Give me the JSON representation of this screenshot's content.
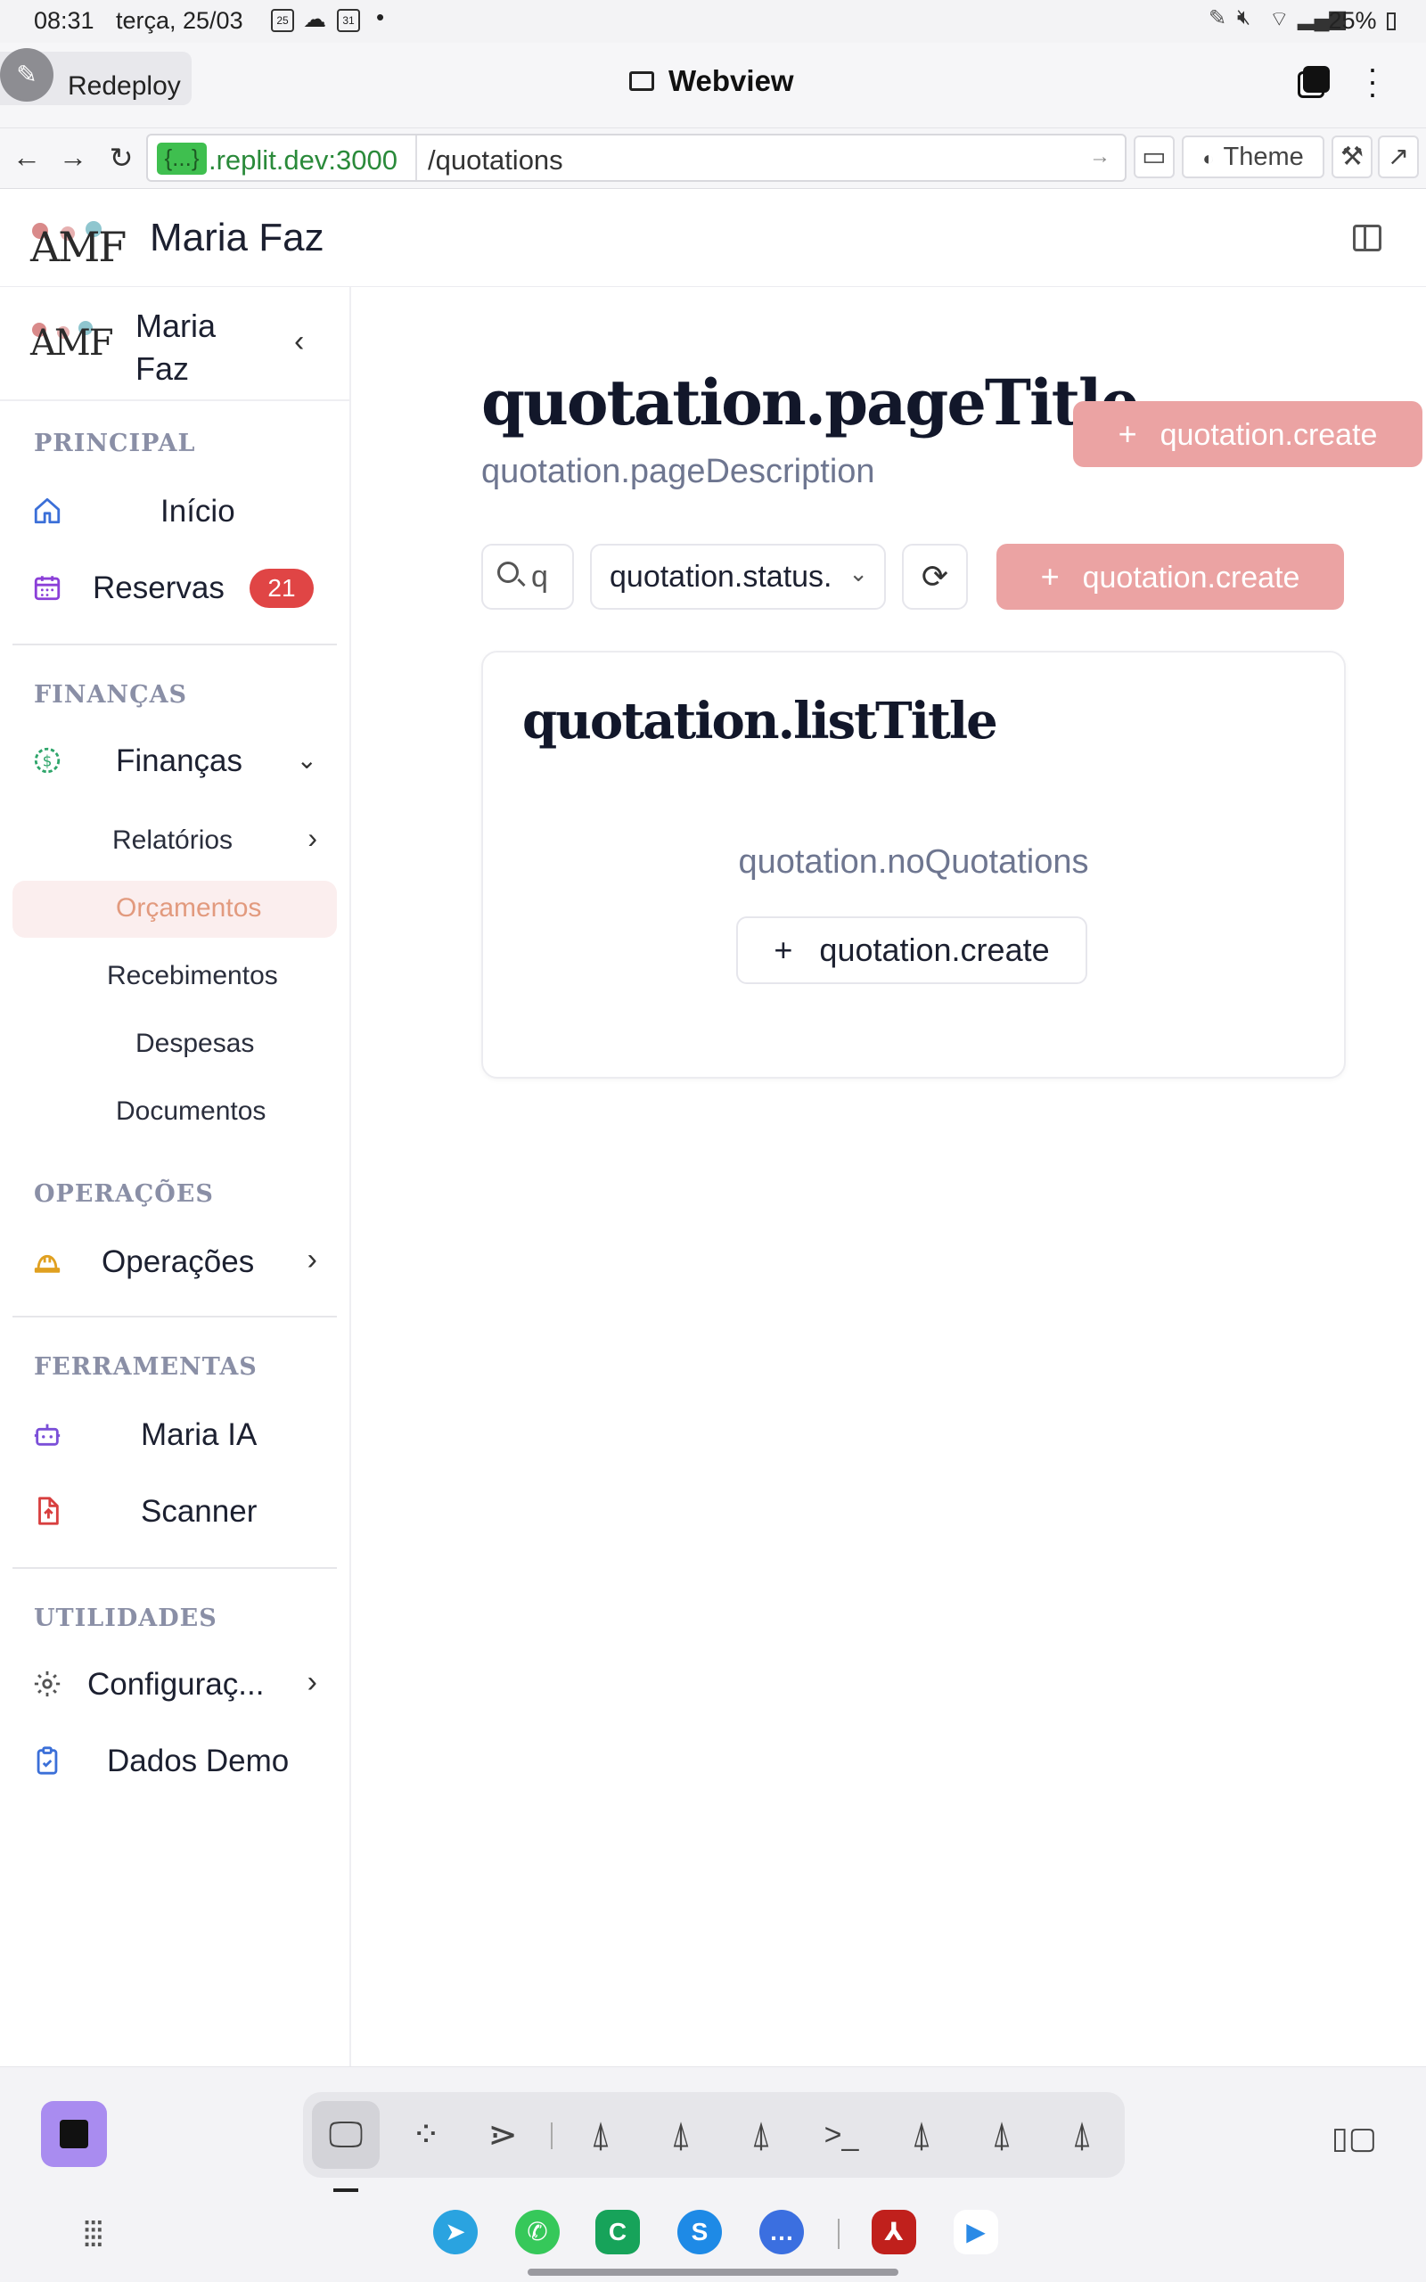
{
  "statusbar": {
    "time": "08:31",
    "date": "terça, 25/03",
    "calendar_day": "25",
    "calendar2_day": "31",
    "battery": "25%"
  },
  "webview": {
    "redeploy_label": "Redeploy",
    "title": "Webview"
  },
  "urlbar": {
    "host_badge": "{...}",
    "host": ".replit.dev:3000",
    "path": "/quotations",
    "theme_label": "Theme"
  },
  "app": {
    "name": "Maria Faz",
    "logo_text": "AMF"
  },
  "sidebar": {
    "header_name_line1": "Maria",
    "header_name_line2": "Faz",
    "sections": {
      "principal": "PRINCIPAL",
      "financas": "FINANÇAS",
      "operacoes": "OPERAÇÕES",
      "ferramentas": "FERRAMENTAS",
      "utilidades": "UTILIDADES"
    },
    "items": {
      "inicio": "Início",
      "reservas": "Reservas",
      "reservas_badge": "21",
      "financas": "Finanças",
      "relatorios": "Relatórios",
      "orcamentos": "Orçamentos",
      "recebimentos": "Recebimentos",
      "despesas": "Despesas",
      "documentos": "Documentos",
      "operacoes": "Operações",
      "maria_ia": "Maria IA",
      "scanner": "Scanner",
      "configuracoes": "Configuraç...",
      "dados_demo": "Dados Demo"
    }
  },
  "main": {
    "page_title": "quotation.pageTitle",
    "page_description": "quotation.pageDescription",
    "create_label": "quotation.create",
    "search_value": "q",
    "status_select": "quotation.status.",
    "list_title": "quotation.listTitle",
    "empty_text": "quotation.noQuotations",
    "accent_color": "#eba3a3"
  }
}
